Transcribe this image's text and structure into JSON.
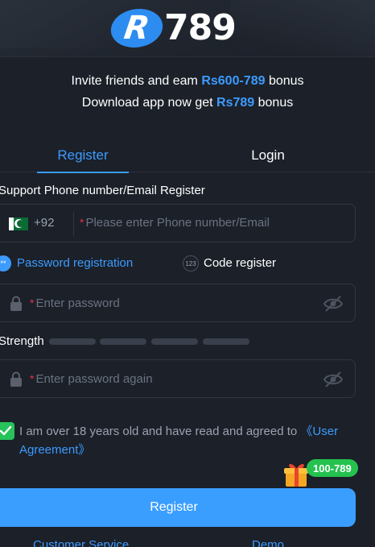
{
  "brand": {
    "logo_letter": "R",
    "logo_number": "789"
  },
  "promo": {
    "line1_prefix": "Invite friends and eam ",
    "line1_highlight": "Rs600-789",
    "line1_suffix": " bonus",
    "line2_prefix": "Download app now get ",
    "line2_highlight": "Rs789",
    "line2_suffix": " bonus"
  },
  "tabs": {
    "register": "Register",
    "login": "Login",
    "active": "register"
  },
  "phone_section": {
    "label": "Support Phone number/Email Register",
    "country_code": "+92",
    "placeholder": "Please enter Phone number/Email",
    "flag": "pakistan-flag"
  },
  "registration_mode": {
    "password_label": "Password registration",
    "password_badge": "**",
    "code_label": "Code register",
    "code_badge": "123",
    "selected": "password"
  },
  "password": {
    "placeholder": "Enter password"
  },
  "strength": {
    "label": "Strength",
    "level": 0,
    "segments": 4
  },
  "confirm_password": {
    "placeholder": "Enter password again"
  },
  "agreement": {
    "text": "I am over 18 years old and have read and agreed to ",
    "link": "《User Agreement》",
    "checked": true
  },
  "gift": {
    "badge": "100-789"
  },
  "register_button": "Register",
  "footer": {
    "customer_service": "Customer Service",
    "demo": "Demo"
  },
  "colors": {
    "background": "#1b2029",
    "accent": "#3d9bff",
    "required": "#e2344a",
    "check": "#27c25a",
    "badge": "#25c24f"
  }
}
